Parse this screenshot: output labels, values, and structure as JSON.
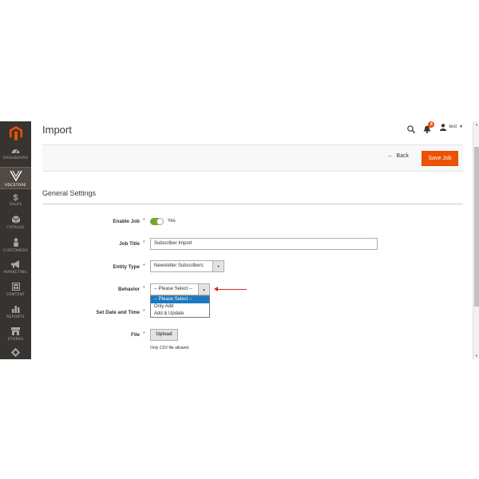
{
  "sidebar": {
    "items": [
      {
        "label": "DASHBOARD",
        "icon": "dashboard-icon"
      },
      {
        "label": "VDCSTORE",
        "icon": "vdcstore-logo-icon"
      },
      {
        "label": "SALES",
        "icon": "dollar-icon"
      },
      {
        "label": "CATALOG",
        "icon": "cube-icon"
      },
      {
        "label": "CUSTOMERS",
        "icon": "person-icon"
      },
      {
        "label": "MARKETING",
        "icon": "megaphone-icon"
      },
      {
        "label": "CONTENT",
        "icon": "content-icon"
      },
      {
        "label": "REPORTS",
        "icon": "bar-chart-icon"
      },
      {
        "label": "STORES",
        "icon": "store-icon"
      }
    ]
  },
  "header": {
    "title": "Import",
    "notification_count": "8",
    "user_name": "test"
  },
  "actions": {
    "back_label": "Back",
    "save_label": "Save Job"
  },
  "section": {
    "title": "General Settings"
  },
  "form": {
    "enable_job": {
      "label": "Enable Job",
      "value": "Yes"
    },
    "job_title": {
      "label": "Job Title",
      "value": "Subscriber Import"
    },
    "entity_type": {
      "label": "Entity Type",
      "value": "Newsletter Subscribers"
    },
    "behavior": {
      "label": "Behavior",
      "value": "-- Please Select --",
      "options": [
        "-- Please Select --",
        "Only Add",
        "Add & Update"
      ]
    },
    "set_date_time": {
      "label": "Set Date and Time"
    },
    "file": {
      "label": "File",
      "button": "Upload",
      "note": "Only CSV file allowed."
    }
  },
  "colors": {
    "accent": "#eb5202",
    "sidebar": "#373330",
    "toggle_on": "#79a22e",
    "selected_option": "#1979c3",
    "annotation_arrow": "#e22626"
  }
}
